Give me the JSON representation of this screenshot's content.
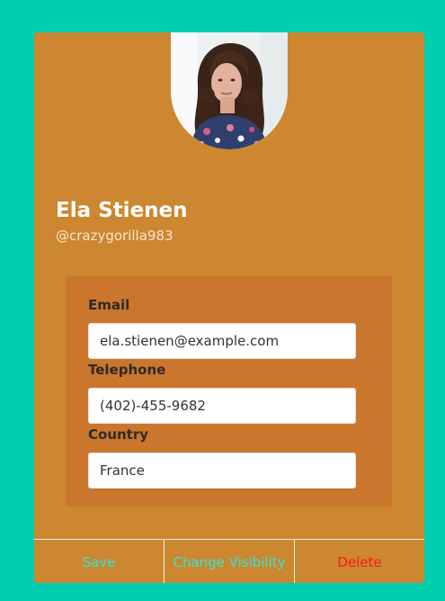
{
  "profile": {
    "name": "Ela Stienen",
    "handle": "@crazygorilla983",
    "avatar_icon": "profile-photo"
  },
  "fields": {
    "email": {
      "label": "Email",
      "value": "ela.stienen@example.com"
    },
    "telephone": {
      "label": "Telephone",
      "value": "(402)-455-9682"
    },
    "country": {
      "label": "Country",
      "value": "France"
    }
  },
  "actions": {
    "save_label": "Save",
    "visibility_label": "Change Visibility",
    "delete_label": "Delete"
  },
  "colors": {
    "background": "#00CFAF",
    "card": "#CC8730",
    "panel": "#CA762C",
    "action_text": "#33E6D8",
    "delete_text": "#FF1A1A"
  }
}
